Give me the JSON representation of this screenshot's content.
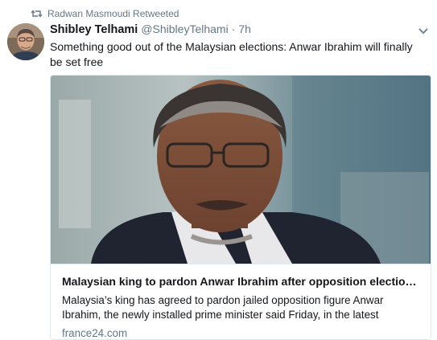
{
  "retweet": {
    "icon": "retweet-icon",
    "label": "Radwan Masmoudi Retweeted"
  },
  "tweet": {
    "author_name": "Shibley Telhami",
    "author_handle": "@ShibleyTelhami",
    "separator": "·",
    "time": "7h",
    "text": "Something good out of the Malaysian elections: Anwar Ibrahim will finally be set free",
    "menu_icon": "chevron-down-icon"
  },
  "card": {
    "title": "Malaysian king to pardon Anwar Ibrahim after opposition election vic...",
    "description": "Malaysia’s king has agreed to pardon jailed opposition figure Anwar Ibrahim, the newly installed prime minister said Friday, in the latest dramatic devel...",
    "domain": "france24.com"
  },
  "colors": {
    "text": "#14171a",
    "secondary": "#657786",
    "border": "#e1e8ed"
  }
}
